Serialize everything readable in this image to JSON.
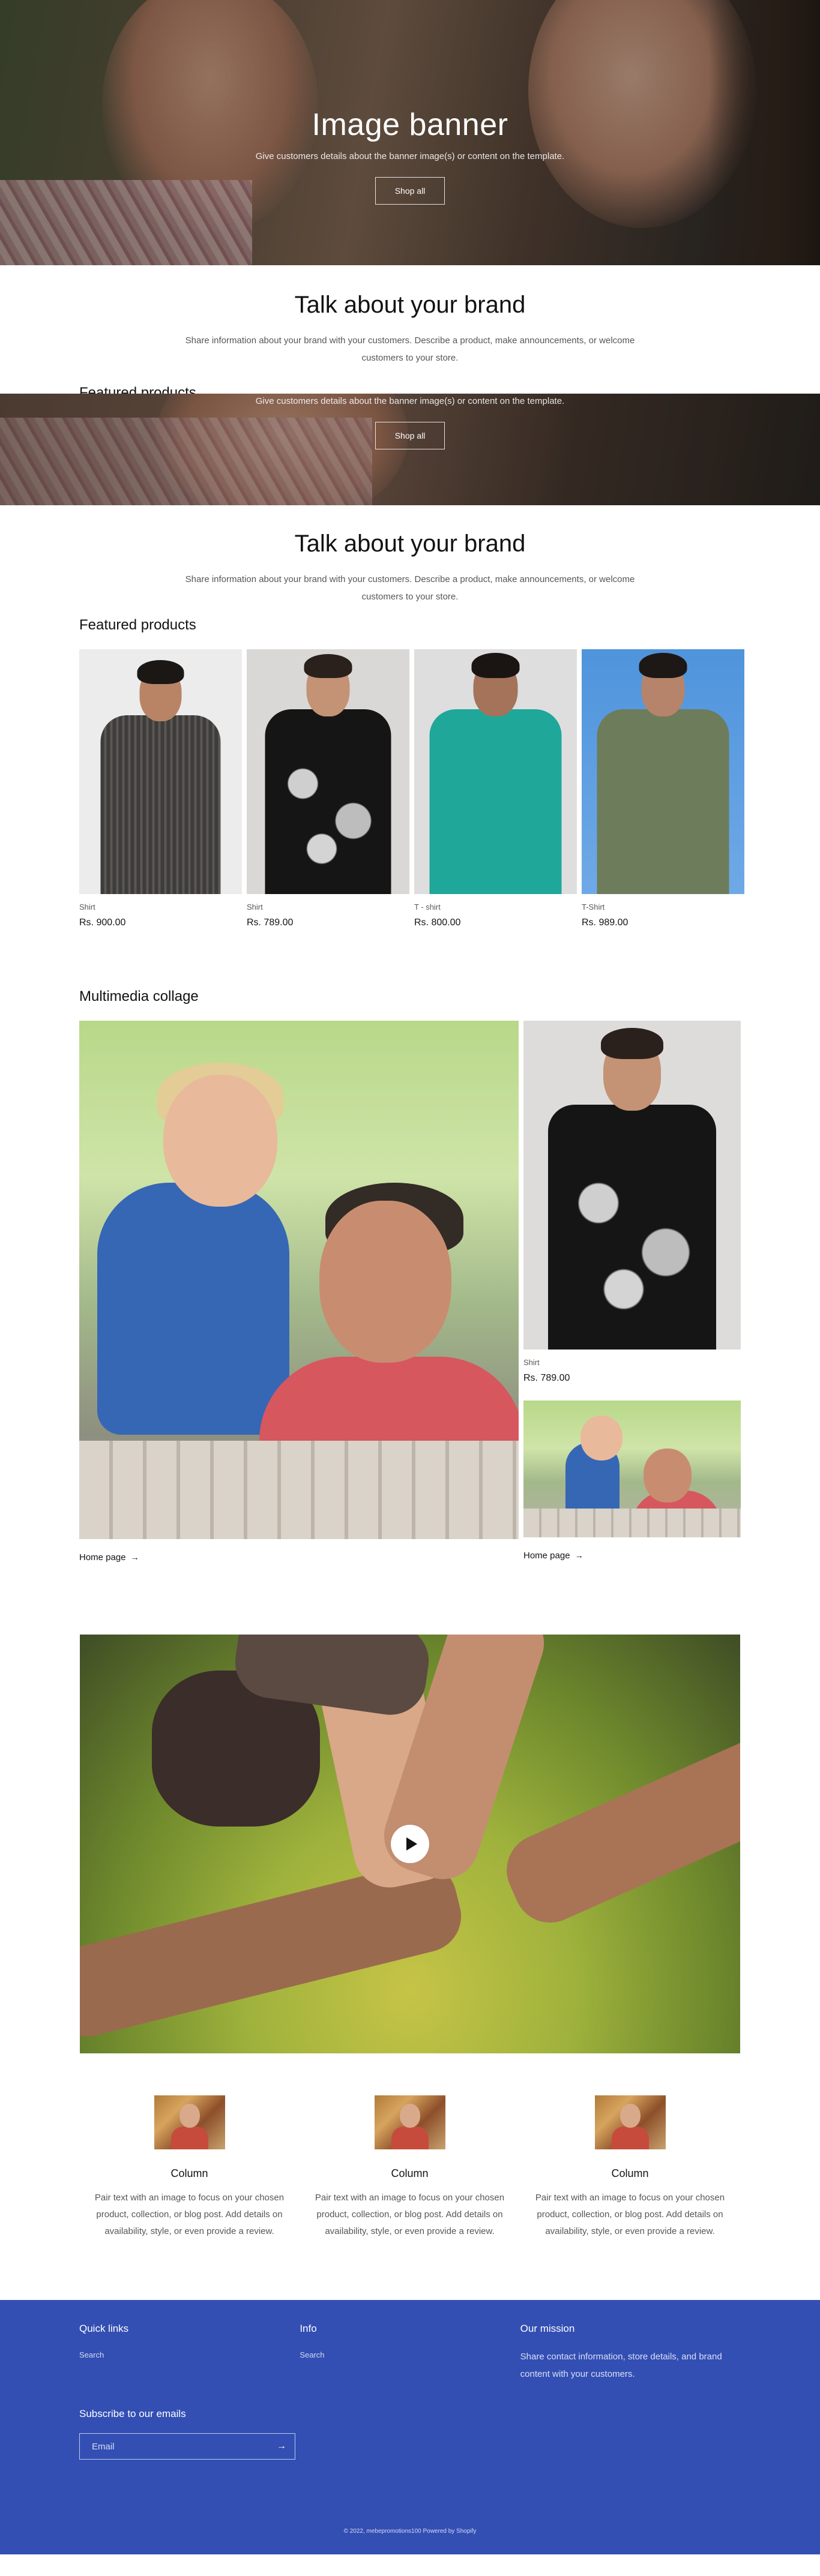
{
  "banner": {
    "title": "Image banner",
    "subtitle": "Give customers details about the banner image(s) or content on the template.",
    "button": "Shop all"
  },
  "brand": {
    "title": "Talk about your brand",
    "text": "Share information about your brand with your customers. Describe a product, make announcements, or welcome customers to your store."
  },
  "overlap_heading": "Featured products",
  "banner2": {
    "subtitle": "Give customers details about the banner image(s) or content on the template.",
    "button": "Shop all"
  },
  "brand2": {
    "title": "Talk about your brand",
    "text": "Share information about your brand with your customers. Describe a product, make announcements, or welcome customers to your store."
  },
  "featured": {
    "title": "Featured products",
    "products": [
      {
        "name": "Shirt",
        "price": "Rs. 900.00",
        "image": "grey-checked-shirt"
      },
      {
        "name": "Shirt",
        "price": "Rs. 789.00",
        "image": "black-floral-shirt"
      },
      {
        "name": "T - shirt",
        "price": "Rs. 800.00",
        "image": "teal-polo-tshirt"
      },
      {
        "name": "T-Shirt",
        "price": "Rs. 989.00",
        "image": "olive-polo-tshirt"
      }
    ]
  },
  "collage": {
    "title": "Multimedia collage",
    "main_link": "Home page",
    "product": {
      "name": "Shirt",
      "price": "Rs. 789.00"
    },
    "side_link": "Home page"
  },
  "video": {
    "icon": "play-icon"
  },
  "columns": [
    {
      "title": "Column",
      "text": "Pair text with an image to focus on your chosen product, collection, or blog post. Add details on availability, style, or even provide a review."
    },
    {
      "title": "Column",
      "text": "Pair text with an image to focus on your chosen product, collection, or blog post. Add details on availability, style, or even provide a review."
    },
    {
      "title": "Column",
      "text": "Pair text with an image to focus on your chosen product, collection, or blog post. Add details on availability, style, or even provide a review."
    }
  ],
  "footer": {
    "quick_links": {
      "title": "Quick links",
      "link": "Search"
    },
    "info": {
      "title": "Info",
      "link": "Search"
    },
    "mission": {
      "title": "Our mission",
      "text": "Share contact information, store details, and brand content with your customers."
    },
    "subscribe": {
      "title": "Subscribe to our emails",
      "placeholder": "Email"
    },
    "copyright": "© 2022, mebepromotions100 Powered by Shopify"
  },
  "colors": {
    "footer_bg": "#334fb4",
    "text": "#121212"
  }
}
